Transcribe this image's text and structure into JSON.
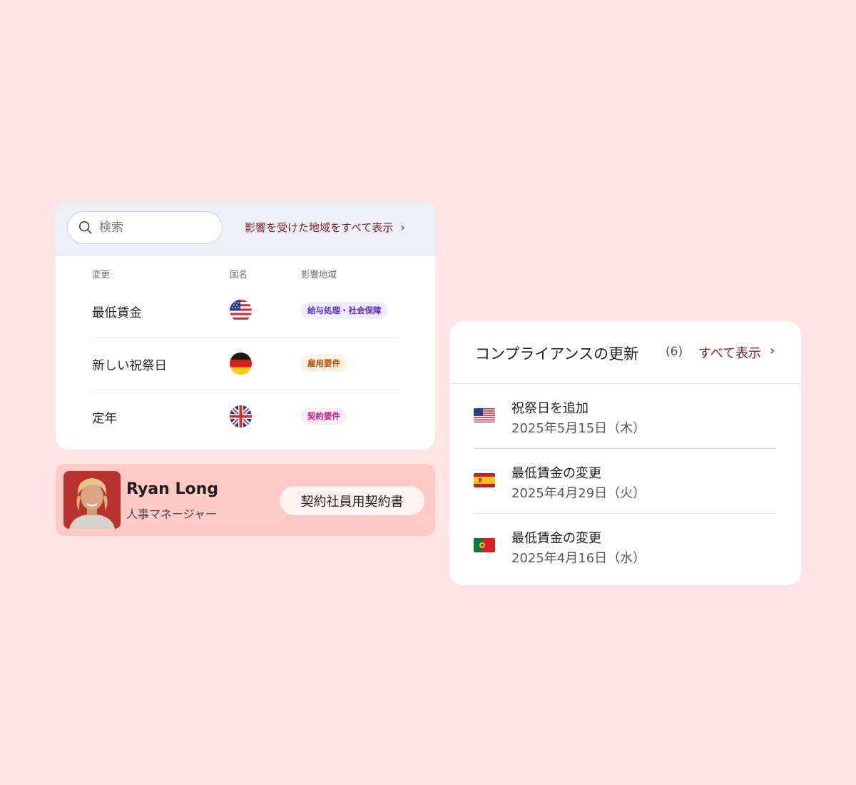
{
  "changes_panel": {
    "search": {
      "placeholder": "検索"
    },
    "affected_link": "影響を受けた地域をすべて表示",
    "columns": {
      "change": "変更",
      "country": "国名",
      "area": "影響地域"
    },
    "rows": [
      {
        "change": "最低賃金",
        "flag_icon": "us-flag-icon",
        "tag": "給与処理・社会保障",
        "tag_color": "#5a2bd8"
      },
      {
        "change": "新しい祝祭日",
        "flag_icon": "germany-flag-icon",
        "tag": "雇用要件",
        "tag_color": "#b34e0c"
      },
      {
        "change": "定年",
        "flag_icon": "uk-flag-icon",
        "tag": "契約要件",
        "tag_color": "#c11f83"
      }
    ]
  },
  "person": {
    "name": "Ryan Long",
    "role": "人事マネージャー",
    "button": "契約社員用契約書"
  },
  "compliance": {
    "title": "コンプライアンスの更新",
    "count": "(6)",
    "view_all": "すべて表示",
    "items": [
      {
        "title": "祝祭日を追加",
        "date": "2025年5月15日（木）",
        "flag_icon": "us-flag-icon"
      },
      {
        "title": "最低賃金の変更",
        "date": "2025年4月29日（火）",
        "flag_icon": "spain-flag-icon"
      },
      {
        "title": "最低賃金の変更",
        "date": "2025年4月16日（水）",
        "flag_icon": "portugal-flag-icon"
      }
    ]
  },
  "colors": {
    "background": "#ffe4e4",
    "accent_link": "#7b1f2b",
    "person_strip": "#ffc9c5"
  }
}
